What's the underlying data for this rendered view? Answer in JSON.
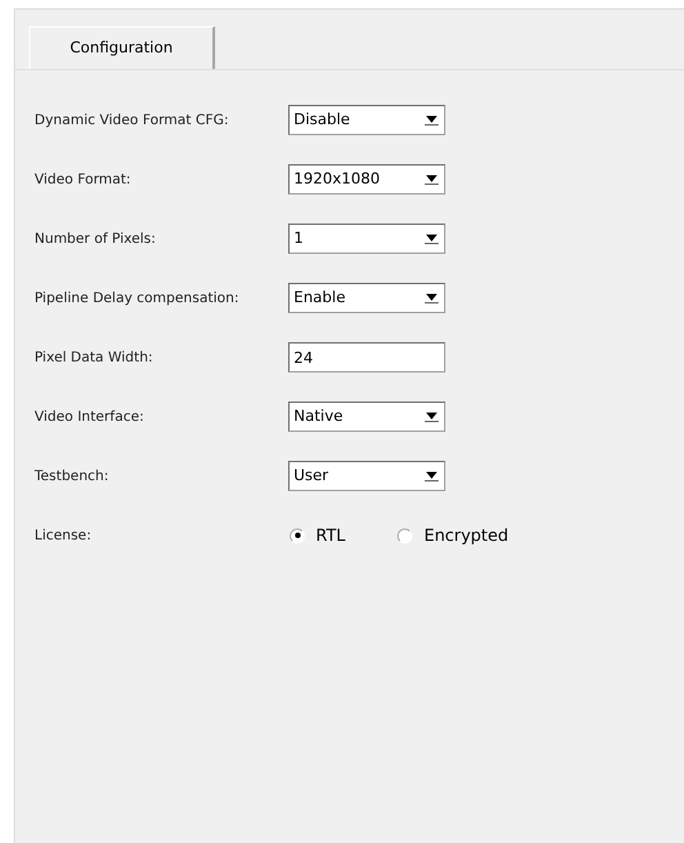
{
  "tabs": [
    {
      "label": "Configuration",
      "selected": true
    }
  ],
  "fields": [
    {
      "kind": "select",
      "label": "Dynamic Video Format CFG:",
      "value": "Disable"
    },
    {
      "kind": "select",
      "label": "Video Format:",
      "value": "1920x1080"
    },
    {
      "kind": "select",
      "label": "Number of Pixels:",
      "value": "1"
    },
    {
      "kind": "select",
      "label": "Pipeline Delay compensation:",
      "value": "Enable"
    },
    {
      "kind": "text",
      "label": "Pixel Data Width:",
      "value": "24"
    },
    {
      "kind": "select",
      "label": "Video Interface:",
      "value": "Native"
    },
    {
      "kind": "select",
      "label": "Testbench:",
      "value": "User"
    },
    {
      "kind": "radio",
      "label": "License:",
      "options": [
        {
          "label": "RTL",
          "selected": true
        },
        {
          "label": "Encrypted",
          "selected": false
        }
      ]
    }
  ]
}
